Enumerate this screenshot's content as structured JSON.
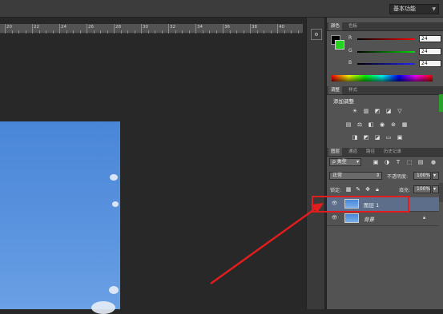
{
  "app": {
    "workspace": "基本功能"
  },
  "ruler": {
    "marks": [
      "20",
      "22",
      "24",
      "26",
      "28",
      "30",
      "32",
      "34",
      "36",
      "38",
      "40"
    ]
  },
  "panel_tabs_top": [
    "颜色",
    "色板"
  ],
  "color": {
    "fg": "#000000",
    "bg": "#22d41e",
    "channels": [
      {
        "label": "R",
        "value": "24",
        "color": "#e03a3a"
      },
      {
        "label": "G",
        "value": "24",
        "color": "#3cc23c"
      },
      {
        "label": "B",
        "value": "24",
        "color": "#3a5ae0"
      }
    ]
  },
  "adjust_tabs": [
    "调整",
    "样式"
  ],
  "adjust": {
    "title": "添加调整"
  },
  "layers_tabs": [
    "图层",
    "通道",
    "路径",
    "历史记录"
  ],
  "layers": {
    "filter_kind": "ρ 类型",
    "blend_mode": "正常",
    "opacity_label": "不透明度:",
    "opacity_value": "100%",
    "lock_label": "锁定:",
    "fill_label": "填充:",
    "fill_value": "100%",
    "items": [
      {
        "name": "图层 1"
      },
      {
        "name": "背景"
      }
    ]
  },
  "annotation": {
    "color": "#e21d1d"
  }
}
